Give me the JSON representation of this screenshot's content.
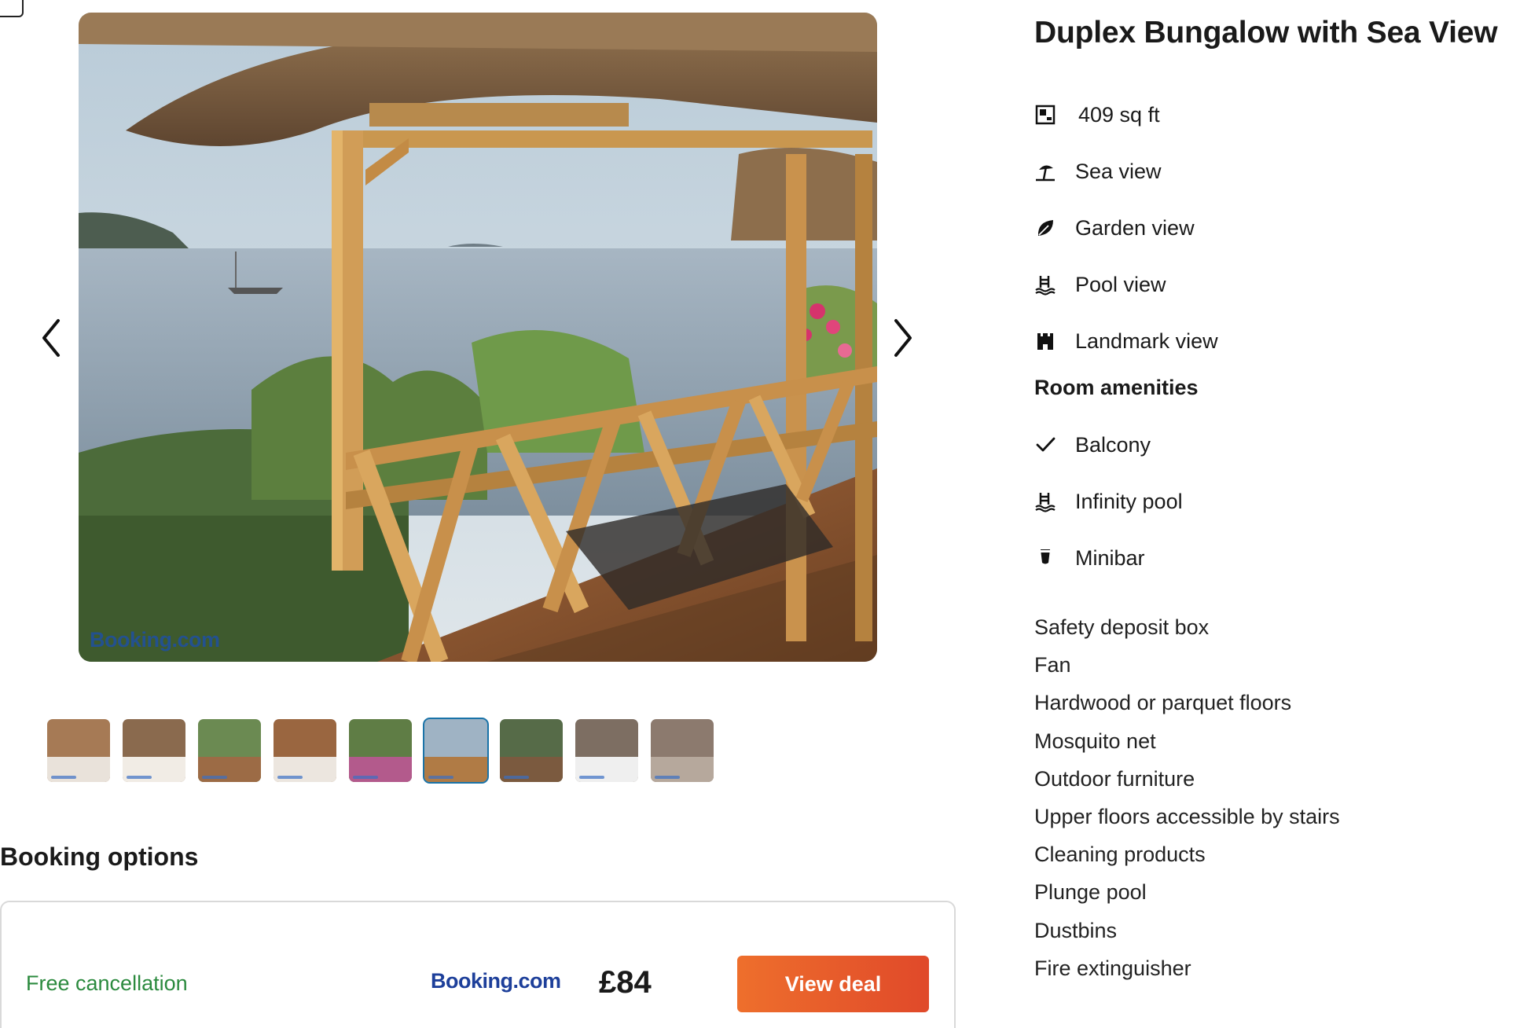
{
  "gallery": {
    "watermark": "Booking.com",
    "prev_icon": "chevron-left-icon",
    "next_icon": "chevron-right-icon",
    "thumbnail_count": 9,
    "active_thumbnail": 6
  },
  "room": {
    "title": "Duplex Bungalow with Sea View",
    "views": [
      {
        "icon": "floor-plan-icon",
        "label": "409 sq ft"
      },
      {
        "icon": "beach-umbrella-icon",
        "label": "Sea view"
      },
      {
        "icon": "leaf-icon",
        "label": "Garden view"
      },
      {
        "icon": "pool-icon",
        "label": "Pool view"
      },
      {
        "icon": "castle-icon",
        "label": "Landmark view"
      }
    ],
    "amenities_heading": "Room amenities",
    "amenities": [
      {
        "icon": "check-icon",
        "label": "Balcony"
      },
      {
        "icon": "pool-icon",
        "label": "Infinity pool"
      },
      {
        "icon": "drink-icon",
        "label": "Minibar"
      }
    ],
    "extras": [
      "Safety deposit box",
      "Fan",
      "Hardwood or parquet floors",
      "Mosquito net",
      "Outdoor furniture",
      "Upper floors accessible by stairs",
      "Cleaning products",
      "Plunge pool",
      "Dustbins",
      "Fire extinguisher"
    ]
  },
  "booking": {
    "heading": "Booking options",
    "free_cancellation": "Free cancellation",
    "provider": "Booking.com",
    "price": "£84",
    "button_label": "View deal"
  },
  "colors": {
    "accent_button": "#e85d2a",
    "free_cancel_green": "#2b8a3e",
    "provider_blue": "#1d3f9a",
    "active_thumb_border": "#1a73a8"
  }
}
